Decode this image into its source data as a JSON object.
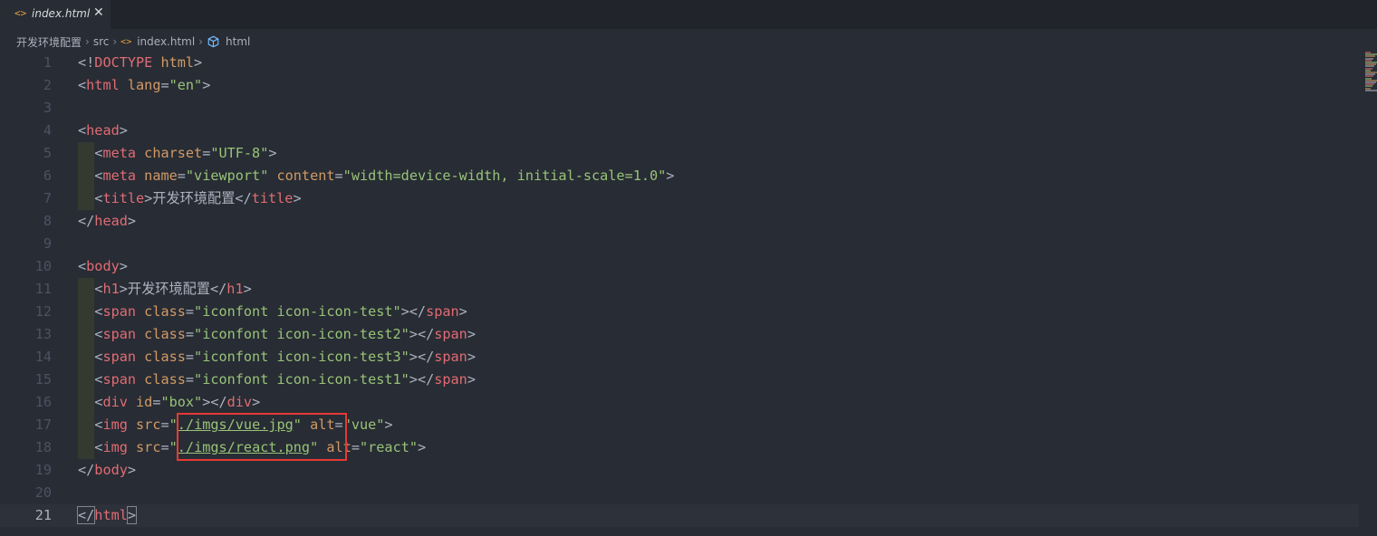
{
  "tab": {
    "icon": "html-file-icon",
    "label": "index.html",
    "close": "✕"
  },
  "breadcrumb": {
    "project": "开发环境配置",
    "folder": "src",
    "file": "index.html",
    "symbol": "html",
    "separator": "›"
  },
  "current_line": 21,
  "highlight_lines": [
    17,
    18
  ],
  "lines": [
    {
      "n": "1",
      "tokens": [
        [
          "p",
          "<!"
        ],
        [
          "t",
          "DOCTYPE"
        ],
        [
          "p",
          " "
        ],
        [
          "a",
          "html"
        ],
        [
          "p",
          ">"
        ]
      ]
    },
    {
      "n": "2",
      "tokens": [
        [
          "p",
          "<"
        ],
        [
          "t",
          "html"
        ],
        [
          "p",
          " "
        ],
        [
          "a",
          "lang"
        ],
        [
          "p",
          "="
        ],
        [
          "s",
          "\"en\""
        ],
        [
          "p",
          ">"
        ]
      ]
    },
    {
      "n": "3",
      "tokens": []
    },
    {
      "n": "4",
      "tokens": [
        [
          "p",
          "<"
        ],
        [
          "t",
          "head"
        ],
        [
          "p",
          ">"
        ]
      ]
    },
    {
      "n": "5",
      "indent": true,
      "tokens": [
        [
          "p",
          "  <"
        ],
        [
          "t",
          "meta"
        ],
        [
          "p",
          " "
        ],
        [
          "a",
          "charset"
        ],
        [
          "p",
          "="
        ],
        [
          "s",
          "\"UTF-8\""
        ],
        [
          "p",
          ">"
        ]
      ]
    },
    {
      "n": "6",
      "indent": true,
      "tokens": [
        [
          "p",
          "  <"
        ],
        [
          "t",
          "meta"
        ],
        [
          "p",
          " "
        ],
        [
          "a",
          "name"
        ],
        [
          "p",
          "="
        ],
        [
          "s",
          "\"viewport\""
        ],
        [
          "p",
          " "
        ],
        [
          "a",
          "content"
        ],
        [
          "p",
          "="
        ],
        [
          "s",
          "\"width=device-width, initial-scale=1.0\""
        ],
        [
          "p",
          ">"
        ]
      ]
    },
    {
      "n": "7",
      "indent": true,
      "tokens": [
        [
          "p",
          "  <"
        ],
        [
          "t",
          "title"
        ],
        [
          "p",
          ">开发环境配置</"
        ],
        [
          "t",
          "title"
        ],
        [
          "p",
          ">"
        ]
      ]
    },
    {
      "n": "8",
      "tokens": [
        [
          "p",
          "</"
        ],
        [
          "t",
          "head"
        ],
        [
          "p",
          ">"
        ]
      ]
    },
    {
      "n": "9",
      "tokens": []
    },
    {
      "n": "10",
      "tokens": [
        [
          "p",
          "<"
        ],
        [
          "t",
          "body"
        ],
        [
          "p",
          ">"
        ]
      ]
    },
    {
      "n": "11",
      "indent": true,
      "tokens": [
        [
          "p",
          "  <"
        ],
        [
          "t",
          "h1"
        ],
        [
          "p",
          ">开发环境配置</"
        ],
        [
          "t",
          "h1"
        ],
        [
          "p",
          ">"
        ]
      ]
    },
    {
      "n": "12",
      "indent": true,
      "tokens": [
        [
          "p",
          "  <"
        ],
        [
          "t",
          "span"
        ],
        [
          "p",
          " "
        ],
        [
          "a",
          "class"
        ],
        [
          "p",
          "="
        ],
        [
          "s",
          "\"iconfont icon-icon-test\""
        ],
        [
          "p",
          "></"
        ],
        [
          "t",
          "span"
        ],
        [
          "p",
          ">"
        ]
      ]
    },
    {
      "n": "13",
      "indent": true,
      "tokens": [
        [
          "p",
          "  <"
        ],
        [
          "t",
          "span"
        ],
        [
          "p",
          " "
        ],
        [
          "a",
          "class"
        ],
        [
          "p",
          "="
        ],
        [
          "s",
          "\"iconfont icon-icon-test2\""
        ],
        [
          "p",
          "></"
        ],
        [
          "t",
          "span"
        ],
        [
          "p",
          ">"
        ]
      ]
    },
    {
      "n": "14",
      "indent": true,
      "tokens": [
        [
          "p",
          "  <"
        ],
        [
          "t",
          "span"
        ],
        [
          "p",
          " "
        ],
        [
          "a",
          "class"
        ],
        [
          "p",
          "="
        ],
        [
          "s",
          "\"iconfont icon-icon-test3\""
        ],
        [
          "p",
          "></"
        ],
        [
          "t",
          "span"
        ],
        [
          "p",
          ">"
        ]
      ]
    },
    {
      "n": "15",
      "indent": true,
      "tokens": [
        [
          "p",
          "  <"
        ],
        [
          "t",
          "span"
        ],
        [
          "p",
          " "
        ],
        [
          "a",
          "class"
        ],
        [
          "p",
          "="
        ],
        [
          "s",
          "\"iconfont icon-icon-test1\""
        ],
        [
          "p",
          "></"
        ],
        [
          "t",
          "span"
        ],
        [
          "p",
          ">"
        ]
      ]
    },
    {
      "n": "16",
      "indent": true,
      "tokens": [
        [
          "p",
          "  <"
        ],
        [
          "t",
          "div"
        ],
        [
          "p",
          " "
        ],
        [
          "a",
          "id"
        ],
        [
          "p",
          "="
        ],
        [
          "s",
          "\"box\""
        ],
        [
          "p",
          "></"
        ],
        [
          "t",
          "div"
        ],
        [
          "p",
          ">"
        ]
      ]
    },
    {
      "n": "17",
      "indent": true,
      "tokens": [
        [
          "p",
          "  <"
        ],
        [
          "t",
          "img"
        ],
        [
          "p",
          " "
        ],
        [
          "a",
          "src"
        ],
        [
          "p",
          "="
        ],
        [
          "s",
          "\""
        ],
        [
          "su",
          "./imgs/vue.jpg"
        ],
        [
          "s",
          "\""
        ],
        [
          "p",
          " "
        ],
        [
          "a",
          "alt"
        ],
        [
          "p",
          "="
        ],
        [
          "s",
          "\"vue\""
        ],
        [
          "p",
          ">"
        ]
      ]
    },
    {
      "n": "18",
      "indent": true,
      "tokens": [
        [
          "p",
          "  <"
        ],
        [
          "t",
          "img"
        ],
        [
          "p",
          " "
        ],
        [
          "a",
          "src"
        ],
        [
          "p",
          "="
        ],
        [
          "s",
          "\""
        ],
        [
          "su",
          "./imgs/react.png"
        ],
        [
          "s",
          "\""
        ],
        [
          "p",
          " "
        ],
        [
          "a",
          "alt"
        ],
        [
          "p",
          "="
        ],
        [
          "s",
          "\"react\""
        ],
        [
          "p",
          ">"
        ]
      ]
    },
    {
      "n": "19",
      "tokens": [
        [
          "p",
          "</"
        ],
        [
          "t",
          "body"
        ],
        [
          "p",
          ">"
        ]
      ]
    },
    {
      "n": "20",
      "tokens": []
    },
    {
      "n": "21",
      "tokens": [
        [
          "pb",
          "</"
        ],
        [
          "t",
          "html"
        ],
        [
          "pb",
          ">"
        ]
      ]
    }
  ],
  "colors": {
    "background": "#282c34",
    "tag": "#e06c75",
    "attribute": "#d19a66",
    "string": "#98c379",
    "punctuation": "#abb2bf",
    "highlight_box": "#e53935"
  }
}
